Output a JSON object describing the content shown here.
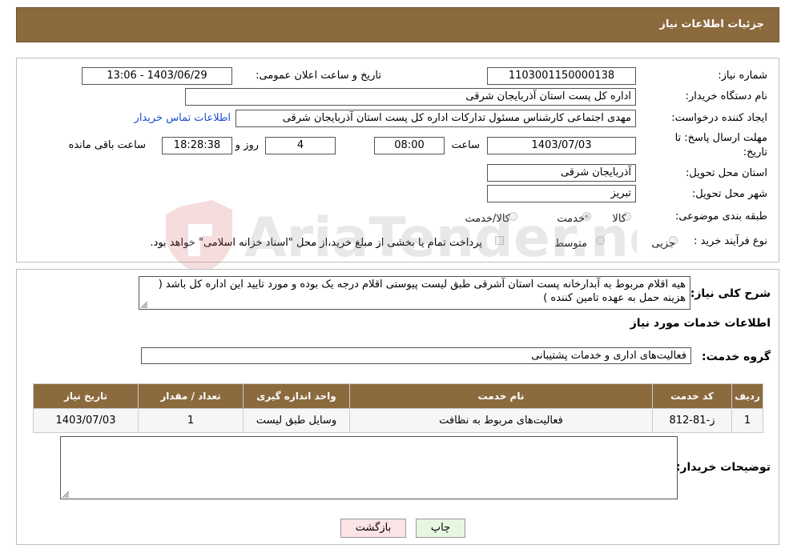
{
  "header": {
    "title": "جزئیات اطلاعات نیاز"
  },
  "form": {
    "need_number": {
      "label": "شماره نیاز:",
      "value": "1103001150000138"
    },
    "announce_datetime": {
      "label": "تاریخ و ساعت اعلان عمومی:",
      "value": "1403/06/29 - 13:06"
    },
    "buyer_org": {
      "label": "نام دستگاه خریدار:",
      "value": "اداره کل پست استان آذربایجان شرقی"
    },
    "requester": {
      "label": "ایجاد کننده درخواست:",
      "value": "مهدی اجتماعی کارشناس مسئول تدارکات اداره کل پست استان آذربایجان شرقی"
    },
    "contact_link": "اطلاعات تماس خریدار",
    "deadline": {
      "label_line1": "مهلت ارسال پاسخ: تا",
      "label_line2": "تاریخ:",
      "date": "1403/07/03",
      "time_label": "ساعت",
      "time": "08:00",
      "days": "4",
      "days_label": "روز و",
      "remaining": "18:28:38",
      "remaining_label": "ساعت باقی مانده"
    },
    "province": {
      "label": "استان محل تحویل:",
      "value": "آذربایجان شرقی"
    },
    "city": {
      "label": "شهر محل تحویل:",
      "value": "تبریز"
    },
    "category": {
      "label": "طبقه بندی موضوعی:",
      "options": [
        {
          "label": "کالا",
          "checked": false
        },
        {
          "label": "خدمت",
          "checked": true
        },
        {
          "label": "کالا/خدمت",
          "checked": false
        }
      ]
    },
    "purchase_type": {
      "label": "نوع فرآیند خرید :",
      "options": [
        {
          "label": "جزیی",
          "checked": false
        },
        {
          "label": "متوسط",
          "checked": false
        }
      ],
      "payment_note": "پرداخت تمام یا بخشی از مبلغ خرید،از محل \"اسناد خزانه اسلامی\" خواهد بود.",
      "payment_checked": false
    }
  },
  "details": {
    "description_label": "شرح کلی نیاز:",
    "description": "هیه اقلام مربوط به آبدارخانه پست استان آشرقی طبق لیست پیوستی اقلام درجه یک بوده و مورد تایید این اداره کل باشد ( هزینه حمل به عهده تامین کننده )",
    "services_title": "اطلاعات خدمات مورد نیاز",
    "service_group_label": "گروه خدمت:",
    "service_group": "فعالیت‌های اداری و خدمات پشتیبانی",
    "table": {
      "headers": [
        "ردیف",
        "کد خدمت",
        "نام خدمت",
        "واحد اندازه گیری",
        "تعداد / مقدار",
        "تاریخ نیاز"
      ],
      "rows": [
        [
          "1",
          "ز-81-812",
          "فعالیت‌های مربوط به نظافت",
          "وسایل طبق لیست",
          "1",
          "1403/07/03"
        ]
      ]
    },
    "buyer_notes_label": "توضیحات خریدار:",
    "buyer_notes": ""
  },
  "buttons": {
    "print": "چاپ",
    "back": "بازگشت"
  },
  "watermark": "AriaTender.neT"
}
